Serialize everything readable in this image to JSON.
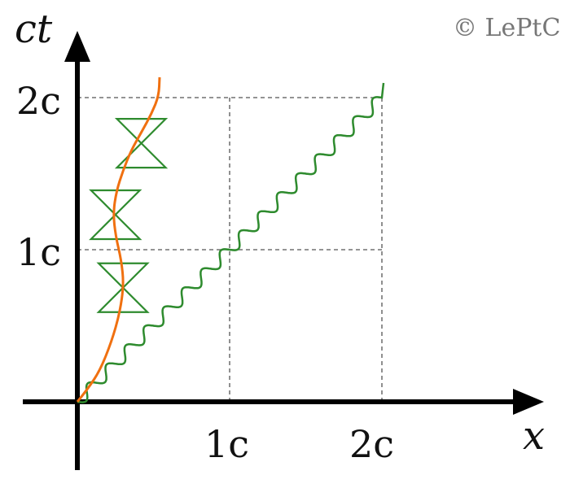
{
  "copyright": "© LePtC",
  "axes": {
    "x_label": "x",
    "y_label": "ct",
    "x_ticks": [
      "1c",
      "2c"
    ],
    "y_ticks": [
      "1c",
      "2c"
    ]
  },
  "colors": {
    "axis": "#000000",
    "grid": "#555555",
    "light_wave": "#2e8b2e",
    "light_cone": "#2e8b2e",
    "worldline": "#f07010"
  },
  "diagram": {
    "units_per_tick": 1,
    "light_wave_from": [
      0,
      0
    ],
    "light_wave_to": [
      2,
      2
    ],
    "light_cones_at": [
      [
        0.3,
        0.75
      ],
      [
        0.25,
        1.23
      ],
      [
        0.42,
        1.7
      ]
    ]
  }
}
